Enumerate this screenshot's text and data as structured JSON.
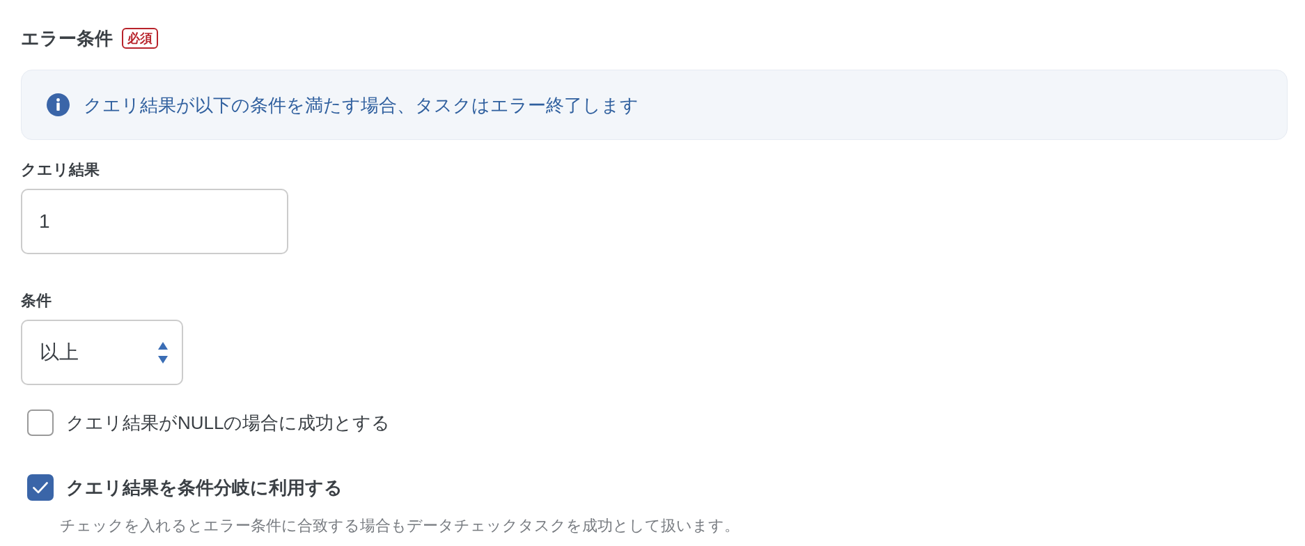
{
  "section": {
    "title": "エラー条件",
    "required_badge": "必須"
  },
  "info": {
    "message": "クエリ結果が以下の条件を満たす場合、タスクはエラー終了します"
  },
  "query_result": {
    "label": "クエリ結果",
    "value": "1"
  },
  "condition": {
    "label": "条件",
    "value": "以上"
  },
  "checkboxes": [
    {
      "label": "クエリ結果がNULLの場合に成功とする",
      "checked": false
    },
    {
      "label": "クエリ結果を条件分岐に利用する",
      "checked": true,
      "description": "チェックを入れるとエラー条件に合致する場合もデータチェックタスクを成功として扱います。"
    }
  ]
}
